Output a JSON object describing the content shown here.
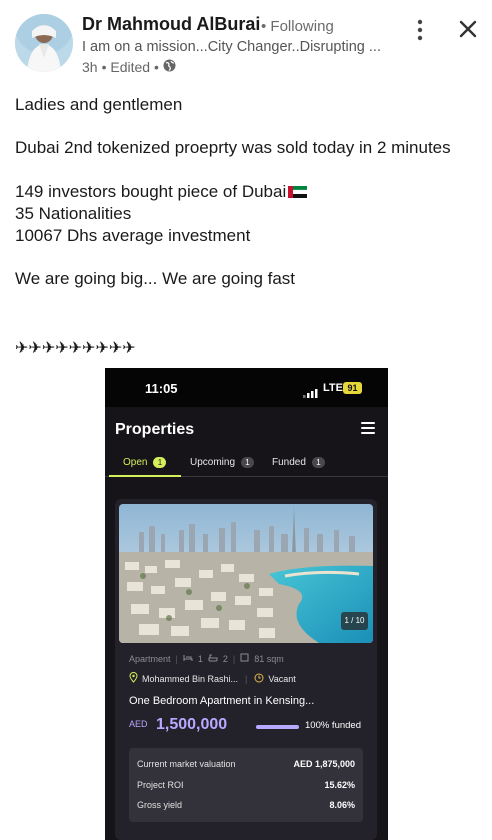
{
  "author": {
    "name": "Dr Mahmoud AlBurai",
    "follow_status": "• Following",
    "headline": "I am on a mission...City Changer..Disrupting ...",
    "time": "3h",
    "edited": "• Edited •",
    "visibility_icon": "globe-icon"
  },
  "post_lines": [
    "Ladies and gentlemen",
    "Dubai 2nd tokenized proeprty was sold today in 2 minutes",
    "149 investors bought piece of Dubai",
    "35 Nationalities",
    "10067 Dhs average investment",
    "We are going big... We are going fast",
    "✈✈✈✈✈✈✈✈✈"
  ],
  "phone": {
    "status": {
      "time": "11:05",
      "network": "LTE",
      "battery": "91"
    },
    "page_title": "Properties",
    "tabs": [
      {
        "label": "Open",
        "count": "1"
      },
      {
        "label": "Upcoming",
        "count": "1"
      },
      {
        "label": "Funded",
        "count": "1"
      }
    ],
    "card": {
      "photo_counter": "1 / 10",
      "type": "Apartment",
      "beds": "1",
      "baths": "2",
      "area": "81 sqm",
      "location": "Mohammed Bin Rashi...",
      "occupancy": "Vacant",
      "title": "One Bedroom Apartment in Kensing...",
      "currency": "AED",
      "price": "1,500,000",
      "funded_fraction": 1.0,
      "funded_label": "100% funded",
      "stats": [
        {
          "label": "Current market valuation",
          "value": "AED 1,875,000"
        },
        {
          "label": "Project ROI",
          "value": "15.62%"
        },
        {
          "label": "Gross yield",
          "value": "8.06%"
        }
      ]
    }
  },
  "colors": {
    "accent_green": "#d4ef5a",
    "accent_purple": "#b9a8ff",
    "phone_bg": "#161418"
  }
}
